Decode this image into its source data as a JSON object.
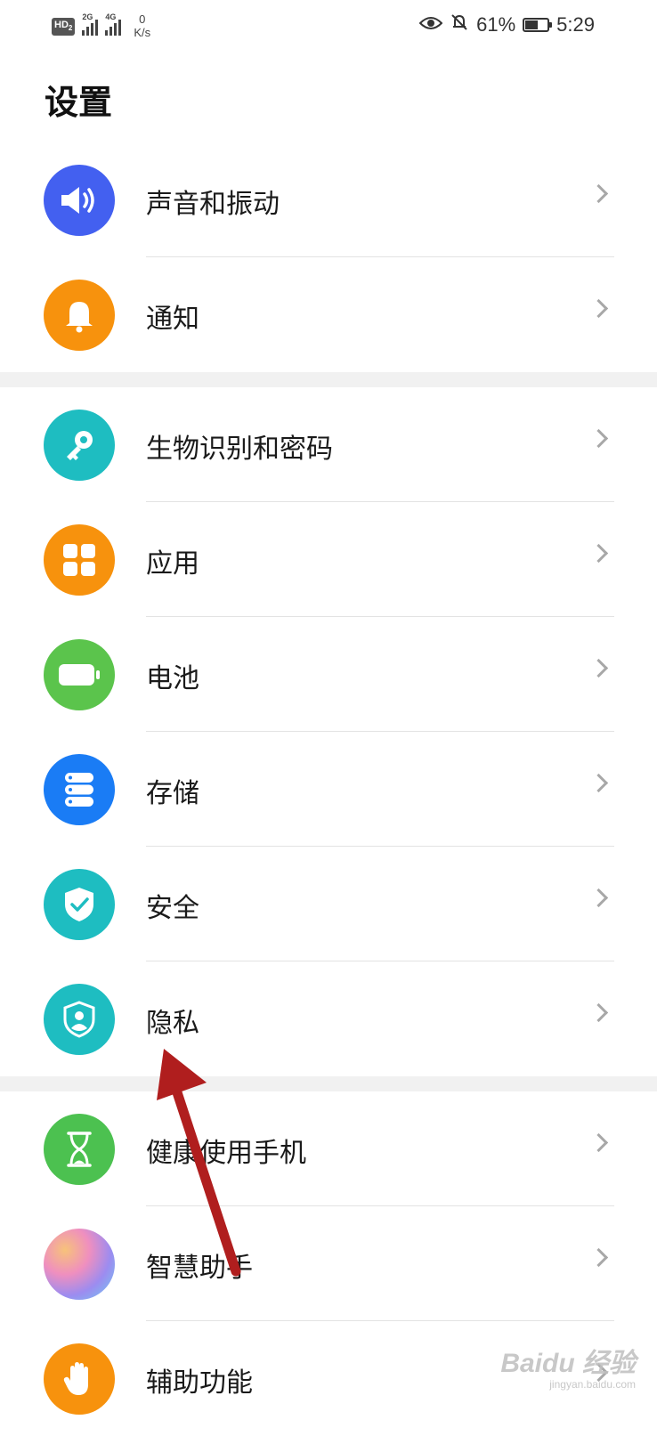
{
  "status_bar": {
    "hd_label": "HD",
    "hd_sub": "2",
    "sim1": "2G",
    "sim2": "4G",
    "speed_value": "0",
    "speed_unit": "K/s",
    "battery_percent": "61%",
    "battery_level": 0.61,
    "time": "5:29"
  },
  "page_title": "设置",
  "groups": [
    [
      {
        "label": "声音和振动",
        "icon": "speaker-icon",
        "color": "#4360F0"
      },
      {
        "label": "通知",
        "icon": "bell-icon",
        "color": "#F7920D"
      }
    ],
    [
      {
        "label": "生物识别和密码",
        "icon": "key-icon",
        "color": "#1EBDC1"
      },
      {
        "label": "应用",
        "icon": "apps-grid-icon",
        "color": "#F7920D"
      },
      {
        "label": "电池",
        "icon": "battery-icon",
        "color": "#5BC44C"
      },
      {
        "label": "存储",
        "icon": "storage-icon",
        "color": "#1A7CF5"
      },
      {
        "label": "安全",
        "icon": "shield-check-icon",
        "color": "#1EBDC1"
      },
      {
        "label": "隐私",
        "icon": "privacy-shield-icon",
        "color": "#1EBDC1"
      }
    ],
    [
      {
        "label": "健康使用手机",
        "icon": "hourglass-icon",
        "color": "#4CC150"
      },
      {
        "label": "智慧助手",
        "icon": "assistant-icon",
        "color": "#E88CC8"
      },
      {
        "label": "辅助功能",
        "icon": "hand-icon",
        "color": "#F7920D"
      }
    ]
  ],
  "annotation_color": "#B01E1E",
  "watermark": {
    "brand": "Baidu 经验",
    "site": "jingyan.baidu.com"
  }
}
